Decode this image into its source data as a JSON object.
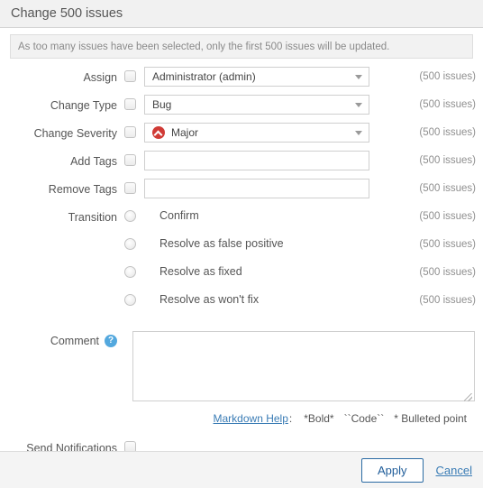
{
  "dialog": {
    "title": "Change 500 issues",
    "notice": "As too many issues have been selected, only the first 500 issues will be updated."
  },
  "fields": {
    "assign": {
      "label": "Assign",
      "value": "Administrator (admin)",
      "count": "(500 issues)"
    },
    "change_type": {
      "label": "Change Type",
      "value": "Bug",
      "count": "(500 issues)"
    },
    "change_severity": {
      "label": "Change Severity",
      "value": "Major",
      "icon": "severity-major-icon",
      "count": "(500 issues)"
    },
    "add_tags": {
      "label": "Add Tags",
      "value": "",
      "placeholder": "",
      "count": "(500 issues)"
    },
    "remove_tags": {
      "label": "Remove Tags",
      "value": "",
      "placeholder": "",
      "count": "(500 issues)"
    },
    "transition": {
      "label": "Transition",
      "options": [
        {
          "label": "Confirm",
          "count": "(500 issues)"
        },
        {
          "label": "Resolve as false positive",
          "count": "(500 issues)"
        },
        {
          "label": "Resolve as fixed",
          "count": "(500 issues)"
        },
        {
          "label": "Resolve as won't fix",
          "count": "(500 issues)"
        }
      ]
    },
    "comment": {
      "label": "Comment",
      "help_icon": "help-icon",
      "value": "",
      "placeholder": ""
    },
    "send_notifications": {
      "label": "Send Notifications"
    }
  },
  "markdown_help": {
    "link": "Markdown Help",
    "colon": ":",
    "bold": "*Bold*",
    "code": "``Code``",
    "bullet": "* Bulleted point"
  },
  "footer": {
    "apply": "Apply",
    "cancel": "Cancel"
  },
  "colors": {
    "accent_link": "#3a7cb5",
    "apply_border": "#2b6ba3",
    "severity_major": "#d03b36",
    "help_icon": "#53a8de",
    "header_bg": "#f1f1f1",
    "footer_bg": "#f4f4f4"
  }
}
